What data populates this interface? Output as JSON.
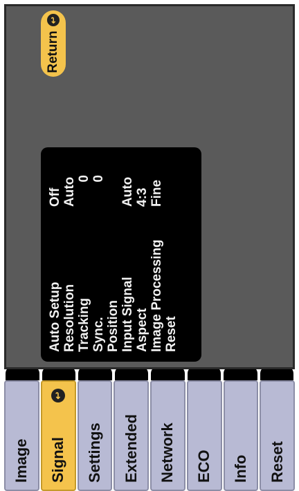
{
  "tabs": [
    {
      "label": "Image"
    },
    {
      "label": "Signal",
      "active": true
    },
    {
      "label": "Settings"
    },
    {
      "label": "Extended"
    },
    {
      "label": "Network"
    },
    {
      "label": "ECO"
    },
    {
      "label": "Info"
    },
    {
      "label": "Reset"
    }
  ],
  "return_label": "Return",
  "menu": [
    {
      "label": "Auto Setup",
      "value": "Off"
    },
    {
      "label": "Resolution",
      "value": "Auto"
    },
    {
      "label": "Tracking",
      "value": "0"
    },
    {
      "label": "Sync.",
      "value": "0"
    },
    {
      "label": "Position",
      "value": ""
    },
    {
      "label": "Input Signal",
      "value": "Auto"
    },
    {
      "label": "Aspect",
      "value": "4:3"
    },
    {
      "label": "Image Processing",
      "value": "Fine"
    },
    {
      "label": "Reset",
      "value": ""
    }
  ]
}
